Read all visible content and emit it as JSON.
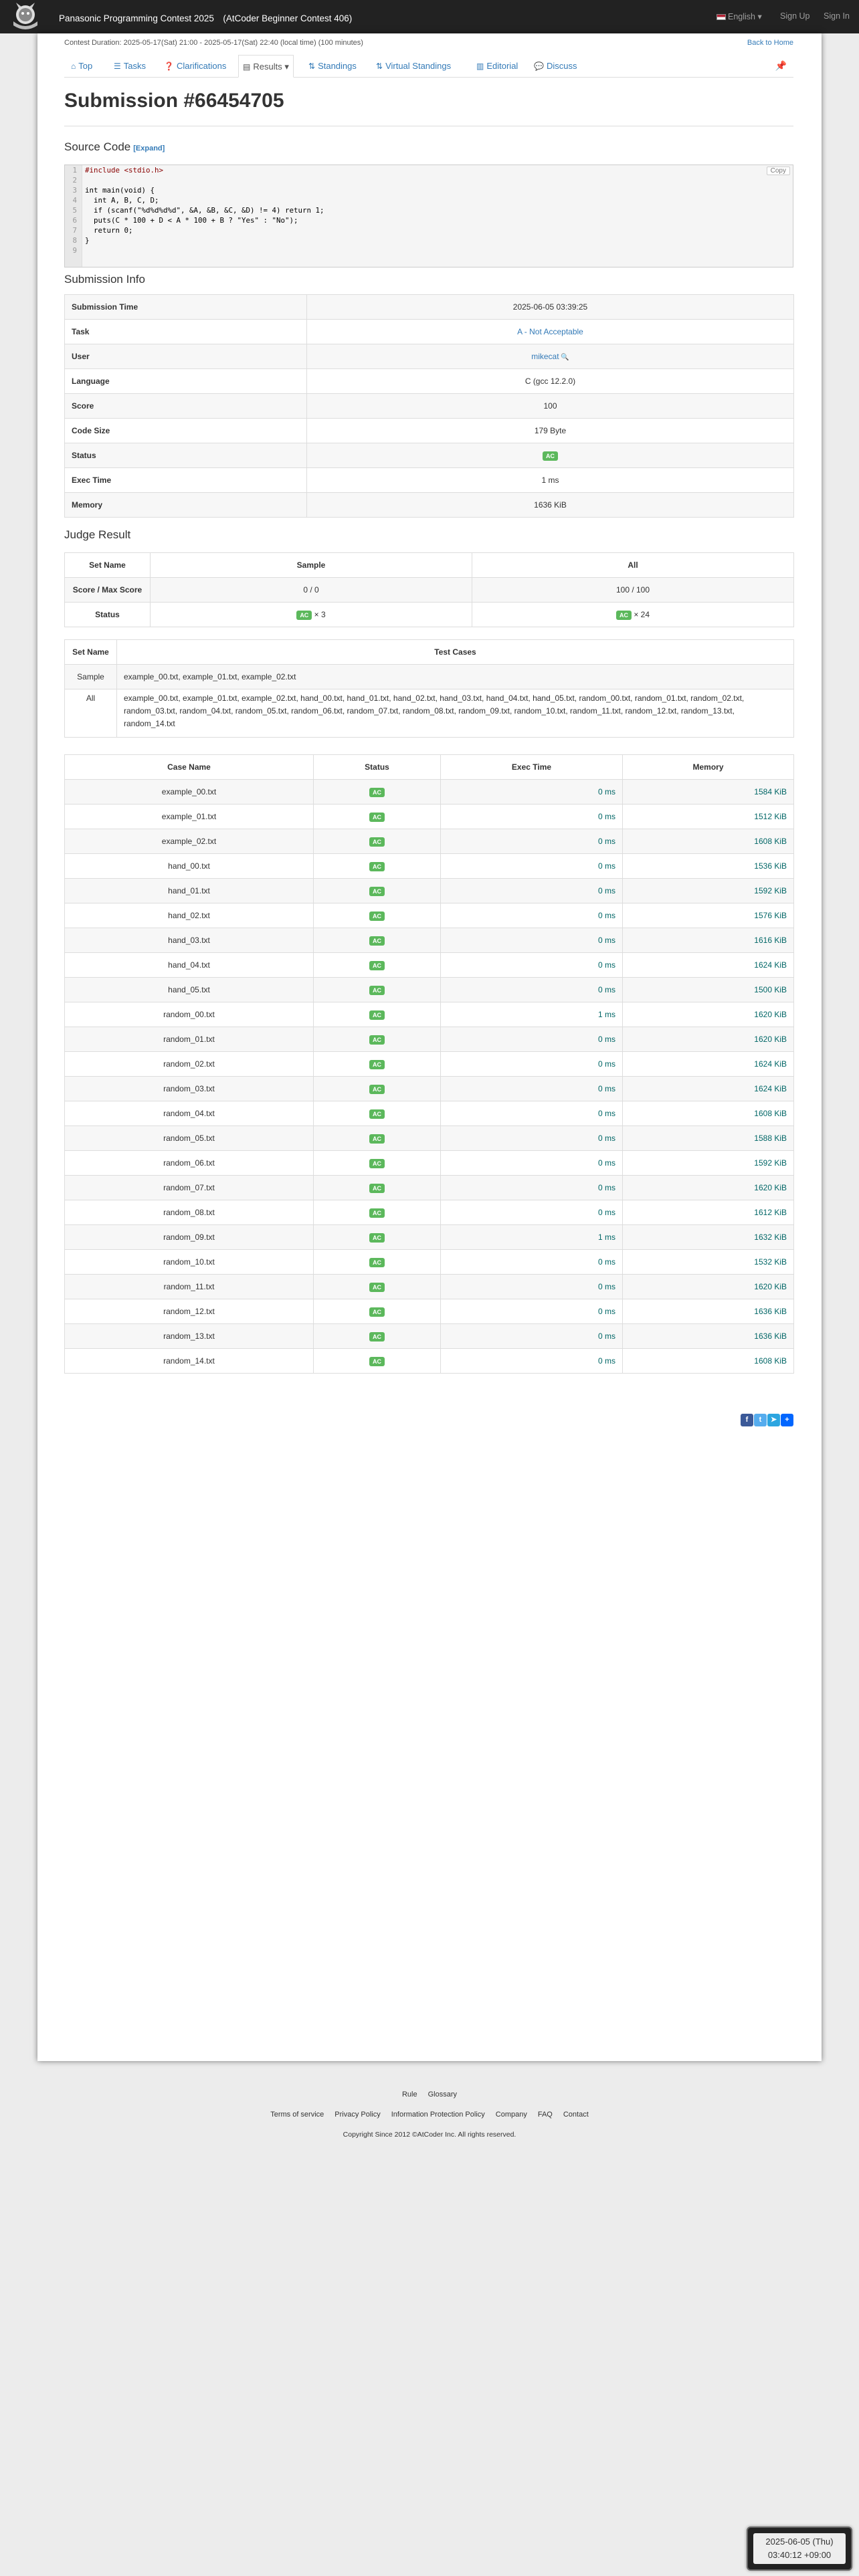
{
  "header": {
    "contest_title": "Panasonic Programming Contest 2025　(AtCoder Beginner Contest 406)",
    "language": "English",
    "sign_up": "Sign Up",
    "sign_in": "Sign In"
  },
  "contest": {
    "duration": "Contest Duration: 2025-05-17(Sat) 21:00 - 2025-05-17(Sat) 22:40 (local time) (100 minutes)",
    "back_home": "Back to Home"
  },
  "nav": {
    "top": "Top",
    "tasks": "Tasks",
    "clarifications": "Clarifications",
    "results": "Results",
    "standings": "Standings",
    "virtual_standings": "Virtual Standings",
    "editorial": "Editorial",
    "discuss": "Discuss"
  },
  "title": "Submission #66454705",
  "source": {
    "heading": "Source Code",
    "expand": "[Expand]",
    "copy": "Copy",
    "lines": [
      "#include <stdio.h>",
      "",
      "int main(void) {",
      "  int A, B, C, D;",
      "  if (scanf(\"%d%d%d%d\", &A, &B, &C, &D) != 4) return 1;",
      "  puts(C * 100 + D < A * 100 + B ? \"Yes\" : \"No\");",
      "  return 0;",
      "}",
      ""
    ]
  },
  "info": {
    "heading": "Submission Info",
    "rows": [
      {
        "key": "Submission Time",
        "value": "2025-06-05 03:39:25"
      },
      {
        "key": "Task",
        "value": "A - Not Acceptable"
      },
      {
        "key": "User",
        "value": "mikecat"
      },
      {
        "key": "Language",
        "value": "C (gcc 12.2.0)"
      },
      {
        "key": "Score",
        "value": "100"
      },
      {
        "key": "Code Size",
        "value": "179 Byte"
      },
      {
        "key": "Status",
        "value": "AC"
      },
      {
        "key": "Exec Time",
        "value": "1 ms"
      },
      {
        "key": "Memory",
        "value": "1636 KiB"
      }
    ]
  },
  "judge": {
    "heading": "Judge Result",
    "col_setname": "Set Name",
    "col_sample": "Sample",
    "col_all": "All",
    "row_score": "Score / Max Score",
    "row_status": "Status",
    "sample_score": "0 / 0",
    "all_score": "100 / 100",
    "sample_status": "AC",
    "sample_count": "× 3",
    "all_status": "AC",
    "all_count": "× 24"
  },
  "sets": {
    "col_setname": "Set Name",
    "col_testcases": "Test Cases",
    "rows": [
      {
        "name": "Sample",
        "cases": "example_00.txt, example_01.txt, example_02.txt"
      },
      {
        "name": "All",
        "cases": "example_00.txt, example_01.txt, example_02.txt, hand_00.txt, hand_01.txt, hand_02.txt, hand_03.txt, hand_04.txt, hand_05.txt, random_00.txt, random_01.txt, random_02.txt, random_03.txt, random_04.txt, random_05.txt, random_06.txt, random_07.txt, random_08.txt, random_09.txt, random_10.txt, random_11.txt, random_12.txt, random_13.txt, random_14.txt"
      }
    ]
  },
  "cases": {
    "col_name": "Case Name",
    "col_status": "Status",
    "col_time": "Exec Time",
    "col_memory": "Memory",
    "rows": [
      {
        "name": "example_00.txt",
        "status": "AC",
        "time": "0 ms",
        "memory": "1584 KiB"
      },
      {
        "name": "example_01.txt",
        "status": "AC",
        "time": "0 ms",
        "memory": "1512 KiB"
      },
      {
        "name": "example_02.txt",
        "status": "AC",
        "time": "0 ms",
        "memory": "1608 KiB"
      },
      {
        "name": "hand_00.txt",
        "status": "AC",
        "time": "0 ms",
        "memory": "1536 KiB"
      },
      {
        "name": "hand_01.txt",
        "status": "AC",
        "time": "0 ms",
        "memory": "1592 KiB"
      },
      {
        "name": "hand_02.txt",
        "status": "AC",
        "time": "0 ms",
        "memory": "1576 KiB"
      },
      {
        "name": "hand_03.txt",
        "status": "AC",
        "time": "0 ms",
        "memory": "1616 KiB"
      },
      {
        "name": "hand_04.txt",
        "status": "AC",
        "time": "0 ms",
        "memory": "1624 KiB"
      },
      {
        "name": "hand_05.txt",
        "status": "AC",
        "time": "0 ms",
        "memory": "1500 KiB"
      },
      {
        "name": "random_00.txt",
        "status": "AC",
        "time": "1 ms",
        "memory": "1620 KiB"
      },
      {
        "name": "random_01.txt",
        "status": "AC",
        "time": "0 ms",
        "memory": "1620 KiB"
      },
      {
        "name": "random_02.txt",
        "status": "AC",
        "time": "0 ms",
        "memory": "1624 KiB"
      },
      {
        "name": "random_03.txt",
        "status": "AC",
        "time": "0 ms",
        "memory": "1624 KiB"
      },
      {
        "name": "random_04.txt",
        "status": "AC",
        "time": "0 ms",
        "memory": "1608 KiB"
      },
      {
        "name": "random_05.txt",
        "status": "AC",
        "time": "0 ms",
        "memory": "1588 KiB"
      },
      {
        "name": "random_06.txt",
        "status": "AC",
        "time": "0 ms",
        "memory": "1592 KiB"
      },
      {
        "name": "random_07.txt",
        "status": "AC",
        "time": "0 ms",
        "memory": "1620 KiB"
      },
      {
        "name": "random_08.txt",
        "status": "AC",
        "time": "0 ms",
        "memory": "1612 KiB"
      },
      {
        "name": "random_09.txt",
        "status": "AC",
        "time": "1 ms",
        "memory": "1632 KiB"
      },
      {
        "name": "random_10.txt",
        "status": "AC",
        "time": "0 ms",
        "memory": "1532 KiB"
      },
      {
        "name": "random_11.txt",
        "status": "AC",
        "time": "0 ms",
        "memory": "1620 KiB"
      },
      {
        "name": "random_12.txt",
        "status": "AC",
        "time": "0 ms",
        "memory": "1636 KiB"
      },
      {
        "name": "random_13.txt",
        "status": "AC",
        "time": "0 ms",
        "memory": "1636 KiB"
      },
      {
        "name": "random_14.txt",
        "status": "AC",
        "time": "0 ms",
        "memory": "1608 KiB"
      }
    ]
  },
  "footer": {
    "links_row1": [
      "Rule",
      "Glossary"
    ],
    "links_row2": [
      "Terms of service",
      "Privacy Policy",
      "Information Protection Policy",
      "Company",
      "FAQ",
      "Contact"
    ],
    "copyright": "Copyright Since 2012 ©AtCoder Inc. All rights reserved."
  },
  "clock": {
    "date": "2025-06-05 (Thu)",
    "time": "03:40:12 +09:00"
  },
  "colors": {
    "header_bg": "#222222",
    "link": "#337ab7",
    "ac_badge": "#5cb85c"
  }
}
